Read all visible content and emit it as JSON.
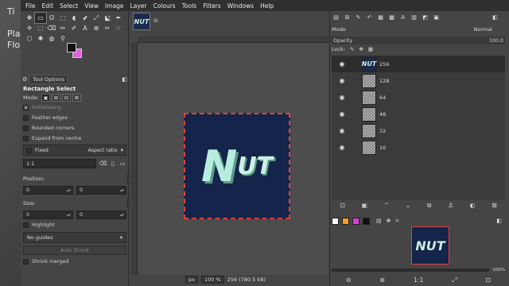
{
  "desktop": {
    "labels": [
      "Ti",
      "Pla",
      "Flo"
    ]
  },
  "menubar": {
    "items": [
      "File",
      "Edit",
      "Select",
      "View",
      "Image",
      "Layer",
      "Colours",
      "Tools",
      "Filters",
      "Windows",
      "Help"
    ]
  },
  "toolbox": {
    "tools_row1": [
      "✥",
      "▭",
      "ʘ",
      "⬚",
      "◖",
      "⬋",
      "⤢",
      "⬕",
      "✒"
    ],
    "tools_row2": [
      "✛",
      "⬚",
      "⌫",
      "✏",
      "✐",
      "A",
      "⊕"
    ],
    "tools_row3": [
      "✂",
      "☞",
      "⬡",
      "✱",
      "◍",
      "⚲"
    ],
    "fg_color": "#111111",
    "bg_color": "#e064e0"
  },
  "tool_options": {
    "tab_label": "Tool Options",
    "title": "Rectangle Select",
    "mode_label": "Mode:",
    "antialiasing": "Antialiasing",
    "feather_edges": "Feather edges",
    "rounded_corners": "Rounded corners",
    "expand_from_centre": "Expand from centre",
    "fixed": "Fixed",
    "fixed_value": "Aspect ratio",
    "ratio_value": "1:1",
    "position_label": "Position:",
    "position_unit": "px",
    "position_x": "0",
    "position_y": "0",
    "size_label": "Size:",
    "size_unit": "px",
    "size_w": "0",
    "size_h": "0",
    "highlight": "Highlight",
    "guides": "No guides",
    "auto_shrink": "Auto Shrink",
    "shrink_merged": "Shrink merged"
  },
  "image": {
    "logo_big": "N",
    "logo_small": "UT",
    "thumb_text": "NUT",
    "status_unit": "px",
    "status_zoom": "100 %",
    "status_text": "256 (780.5 kB)"
  },
  "layers": {
    "mode_label": "Mode",
    "mode_value": "Normal",
    "opacity_label": "Opacity",
    "opacity_value": "100.0",
    "lock_label": "Lock:",
    "items": [
      {
        "name": "256"
      },
      {
        "name": "128"
      },
      {
        "name": "64"
      },
      {
        "name": "48"
      },
      {
        "name": "32"
      },
      {
        "name": "16"
      }
    ]
  },
  "navigator": {
    "zoom": "100%",
    "swatches": [
      "#ffffff",
      "#f0a020",
      "#e03ad0",
      "#101010",
      "#3a3a3a"
    ]
  }
}
